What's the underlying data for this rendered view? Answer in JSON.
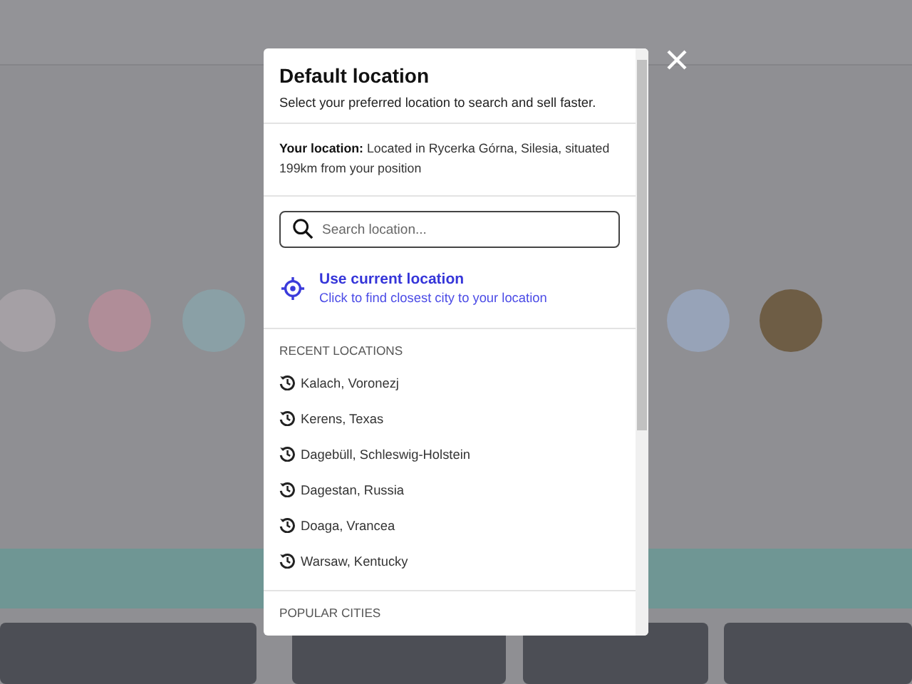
{
  "modal": {
    "title": "Default location",
    "subtitle": "Select your preferred location to search and sell faster.",
    "your_location": {
      "label": "Your location:",
      "text": "Located in Rycerka Górna, Silesia, situated 199km from your position"
    },
    "search": {
      "placeholder": "Search location..."
    },
    "current_location": {
      "title": "Use current location",
      "subtitle": "Click to find closest city to your location"
    },
    "recent_locations": {
      "heading": "RECENT LOCATIONS",
      "items": [
        {
          "label": "Kalach, Voronezj"
        },
        {
          "label": "Kerens, Texas"
        },
        {
          "label": "Dagebüll, Schleswig-Holstein"
        },
        {
          "label": "Dagestan, Russia"
        },
        {
          "label": "Doaga, Vrancea"
        },
        {
          "label": "Warsaw, Kentucky"
        }
      ]
    },
    "popular_cities": {
      "heading": "POPULAR CITIES"
    }
  }
}
